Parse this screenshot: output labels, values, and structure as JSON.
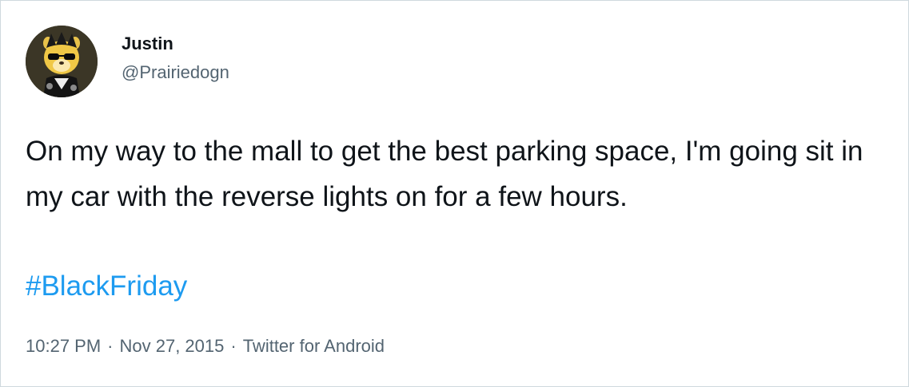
{
  "author": {
    "display_name": "Justin",
    "handle": "@Prairiedogn",
    "avatar_icon": "prairie-dog-sunglasses-avatar-icon"
  },
  "tweet": {
    "text": "On my way to the mall to get the best parking space, I'm going sit in my car with the reverse lights on for a few hours.",
    "hashtag": "#BlackFriday"
  },
  "meta": {
    "time": "10:27 PM",
    "separator": "·",
    "date": "Nov 27, 2015",
    "source": "Twitter for Android"
  },
  "colors": {
    "text": "#0f1419",
    "secondary": "#536471",
    "link": "#1d9bf0",
    "border": "#cfd9de"
  }
}
